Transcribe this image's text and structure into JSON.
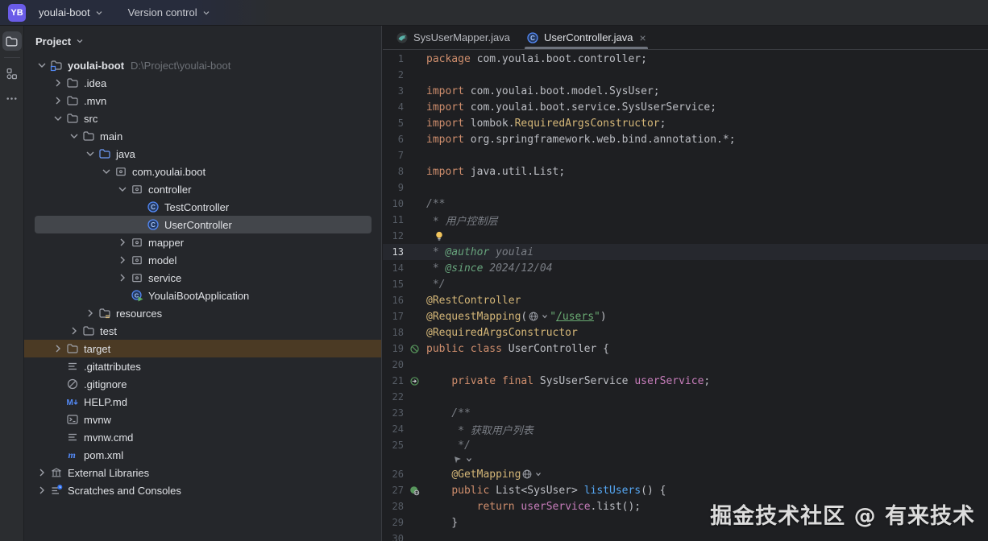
{
  "header": {
    "logo": "YB",
    "project": "youlai-boot",
    "vcs": "Version control"
  },
  "left_strip": {
    "items": [
      {
        "id": "project",
        "icon": "strip-folder",
        "active": true
      },
      {
        "id": "divider",
        "divider": true
      },
      {
        "id": "structure",
        "icon": "strip-structure",
        "active": false
      },
      {
        "id": "more",
        "icon": "strip-more",
        "active": false
      }
    ]
  },
  "project_panel": {
    "title": "Project",
    "tree": [
      {
        "label": "youlai-boot",
        "path": "D:\\Project\\youlai-boot",
        "level": 0,
        "chevron": "expanded",
        "icon": "project-folder",
        "bold": true
      },
      {
        "label": ".idea",
        "level": 1,
        "chevron": "collapsed",
        "icon": "folder"
      },
      {
        "label": ".mvn",
        "level": 1,
        "chevron": "collapsed",
        "icon": "folder"
      },
      {
        "label": "src",
        "level": 1,
        "chevron": "expanded",
        "icon": "folder"
      },
      {
        "label": "main",
        "level": 2,
        "chevron": "expanded",
        "icon": "folder"
      },
      {
        "label": "java",
        "level": 3,
        "chevron": "expanded",
        "icon": "src-folder"
      },
      {
        "label": "com.youlai.boot",
        "level": 4,
        "chevron": "expanded",
        "icon": "package"
      },
      {
        "label": "controller",
        "level": 5,
        "chevron": "expanded",
        "icon": "package"
      },
      {
        "label": "TestController",
        "level": 6,
        "chevron": null,
        "icon": "class"
      },
      {
        "label": "UserController",
        "level": 6,
        "chevron": null,
        "icon": "class",
        "selected": true
      },
      {
        "label": "mapper",
        "level": 5,
        "chevron": "collapsed",
        "icon": "package"
      },
      {
        "label": "model",
        "level": 5,
        "chevron": "collapsed",
        "icon": "package"
      },
      {
        "label": "service",
        "level": 5,
        "chevron": "collapsed",
        "icon": "package"
      },
      {
        "label": "YoulaiBootApplication",
        "level": 5,
        "chevron": null,
        "icon": "class-run"
      },
      {
        "label": "resources",
        "level": 3,
        "chevron": "collapsed",
        "icon": "resources-folder"
      },
      {
        "label": "test",
        "level": 2,
        "chevron": "collapsed",
        "icon": "folder"
      },
      {
        "label": "target",
        "level": 1,
        "chevron": "collapsed",
        "icon": "folder",
        "excluded": true
      },
      {
        "label": ".gitattributes",
        "level": 1,
        "chevron": null,
        "icon": "text-file"
      },
      {
        "label": ".gitignore",
        "level": 1,
        "chevron": null,
        "icon": "ignore-file"
      },
      {
        "label": "HELP.md",
        "level": 1,
        "chevron": null,
        "icon": "markdown-file"
      },
      {
        "label": "mvnw",
        "level": 1,
        "chevron": null,
        "icon": "terminal-file"
      },
      {
        "label": "mvnw.cmd",
        "level": 1,
        "chevron": null,
        "icon": "text-file"
      },
      {
        "label": "pom.xml",
        "level": 1,
        "chevron": null,
        "icon": "maven-file"
      },
      {
        "label": "External Libraries",
        "level": 0,
        "chevron": "collapsed",
        "icon": "libraries"
      },
      {
        "label": "Scratches and Consoles",
        "level": 0,
        "chevron": "collapsed",
        "icon": "scratches"
      }
    ]
  },
  "editor": {
    "tabs": [
      {
        "label": "SysUserMapper.java",
        "icon": "mybatis",
        "active": false
      },
      {
        "label": "UserController.java",
        "icon": "class",
        "active": true,
        "close": "×"
      }
    ],
    "watermark": "掘金技术社区 @ 有来技术",
    "lines": [
      {
        "n": 1,
        "tk": [
          {
            "c": "kw",
            "t": "package"
          },
          {
            "c": "def",
            "t": " com.youlai.boot.controller;"
          }
        ]
      },
      {
        "n": 2,
        "tk": []
      },
      {
        "n": 3,
        "tk": [
          {
            "c": "kw",
            "t": "import"
          },
          {
            "c": "def",
            "t": " com.youlai.boot.model.SysUser;"
          }
        ]
      },
      {
        "n": 4,
        "tk": [
          {
            "c": "kw",
            "t": "import"
          },
          {
            "c": "def",
            "t": " com.youlai.boot.service.SysUserService;"
          }
        ]
      },
      {
        "n": 5,
        "tk": [
          {
            "c": "kw",
            "t": "import"
          },
          {
            "c": "def",
            "t": " lombok."
          },
          {
            "c": "ann",
            "t": "RequiredArgsConstructor"
          },
          {
            "c": "def",
            "t": ";"
          }
        ]
      },
      {
        "n": 6,
        "tk": [
          {
            "c": "kw",
            "t": "import"
          },
          {
            "c": "def",
            "t": " org.springframework.web.bind.annotation.*;"
          }
        ]
      },
      {
        "n": 7,
        "tk": []
      },
      {
        "n": 8,
        "tk": [
          {
            "c": "kw",
            "t": "import"
          },
          {
            "c": "def",
            "t": " java.util.List;"
          }
        ]
      },
      {
        "n": 9,
        "tk": []
      },
      {
        "n": 10,
        "tk": [
          {
            "c": "cmt",
            "t": "/**"
          }
        ]
      },
      {
        "n": 11,
        "tk": [
          {
            "c": "cmt",
            "t": " * 用户控制层"
          }
        ]
      },
      {
        "n": 12,
        "tk": [
          {
            "c": "cmt",
            "t": " "
          },
          {
            "i": "bulb"
          }
        ]
      },
      {
        "n": 13,
        "caret": true,
        "tk": [
          {
            "c": "cmt",
            "t": " * "
          },
          {
            "c": "doc",
            "t": "@author"
          },
          {
            "c": "cmt",
            "t": " youlai"
          }
        ]
      },
      {
        "n": 14,
        "tk": [
          {
            "c": "cmt",
            "t": " * "
          },
          {
            "c": "doc",
            "t": "@since"
          },
          {
            "c": "cmt",
            "t": " 2024/12/04"
          }
        ]
      },
      {
        "n": 15,
        "tk": [
          {
            "c": "cmt",
            "t": " */"
          }
        ]
      },
      {
        "n": 16,
        "tk": [
          {
            "c": "ann",
            "t": "@RestController"
          }
        ]
      },
      {
        "n": 17,
        "tk": [
          {
            "c": "ann",
            "t": "@RequestMapping"
          },
          {
            "c": "def",
            "t": "("
          },
          {
            "i": "globe"
          },
          {
            "i": "chev"
          },
          {
            "c": "str",
            "t": "\""
          },
          {
            "c": "strlink",
            "t": "/users"
          },
          {
            "c": "str",
            "t": "\""
          },
          {
            "c": "def",
            "t": ")"
          }
        ]
      },
      {
        "n": 18,
        "tk": [
          {
            "c": "ann",
            "t": "@RequiredArgsConstructor"
          }
        ]
      },
      {
        "n": 19,
        "g": "bean",
        "tk": [
          {
            "c": "kw",
            "t": "public"
          },
          {
            "c": "def",
            "t": " "
          },
          {
            "c": "kw",
            "t": "class"
          },
          {
            "c": "def",
            "t": " UserController {"
          }
        ]
      },
      {
        "n": 20,
        "tk": []
      },
      {
        "n": 21,
        "g": "autowired",
        "tk": [
          {
            "c": "def",
            "t": "    "
          },
          {
            "c": "kw",
            "t": "private"
          },
          {
            "c": "def",
            "t": " "
          },
          {
            "c": "kw",
            "t": "final"
          },
          {
            "c": "def",
            "t": " SysUserService "
          },
          {
            "c": "fld",
            "t": "userService"
          },
          {
            "c": "def",
            "t": ";"
          }
        ]
      },
      {
        "n": 22,
        "tk": []
      },
      {
        "n": 23,
        "tk": [
          {
            "c": "cmt",
            "t": "    /**"
          }
        ]
      },
      {
        "n": 24,
        "tk": [
          {
            "c": "cmt",
            "t": "     * 获取用户列表"
          }
        ]
      },
      {
        "n": 25,
        "tk": [
          {
            "c": "cmt",
            "t": "     */"
          }
        ]
      },
      {
        "inlay": true,
        "tk": [
          {
            "c": "def",
            "t": "    "
          },
          {
            "i": "ai"
          },
          {
            "i": "chev"
          }
        ]
      },
      {
        "n": 26,
        "tk": [
          {
            "c": "def",
            "t": "    "
          },
          {
            "c": "ann",
            "t": "@GetMapping"
          },
          {
            "i": "globe"
          },
          {
            "i": "chev"
          }
        ]
      },
      {
        "n": 27,
        "g": "url",
        "tk": [
          {
            "c": "def",
            "t": "    "
          },
          {
            "c": "kw",
            "t": "public"
          },
          {
            "c": "def",
            "t": " List<SysUser> "
          },
          {
            "c": "mth",
            "t": "listUsers"
          },
          {
            "c": "def",
            "t": "() {"
          }
        ]
      },
      {
        "n": 28,
        "tk": [
          {
            "c": "def",
            "t": "        "
          },
          {
            "c": "kw",
            "t": "return"
          },
          {
            "c": "def",
            "t": " "
          },
          {
            "c": "fld",
            "t": "userService"
          },
          {
            "c": "def",
            "t": ".list();"
          }
        ]
      },
      {
        "n": 29,
        "tk": [
          {
            "c": "def",
            "t": "    }"
          }
        ]
      },
      {
        "n": 30,
        "tk": []
      }
    ]
  }
}
